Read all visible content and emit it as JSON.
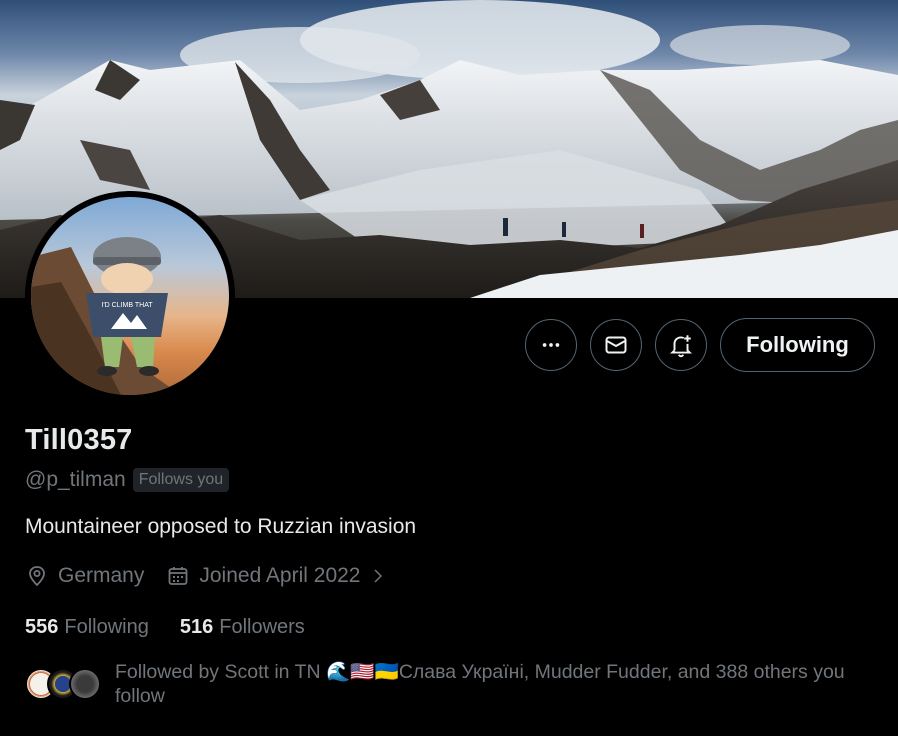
{
  "profile": {
    "display_name": "Till0357",
    "handle": "@p_tilman",
    "follows_you_badge": "Follows you",
    "bio": "Mountaineer opposed to Ruzzian invasion",
    "location": "Germany",
    "joined": "Joined April 2022",
    "avatar_shirt_text": "I'D CLIMB THAT"
  },
  "actions": {
    "more_icon": "more-horizontal-icon",
    "message_icon": "mail-icon",
    "notify_icon": "bell-plus-icon",
    "follow_label": "Following"
  },
  "stats": {
    "following_count": "556",
    "following_label": "Following",
    "followers_count": "516",
    "followers_label": "Followers"
  },
  "followed_by": {
    "text": "Followed by Scott in TN 🌊🇺🇸🇺🇦Слава Україні, Mudder Fudder, and 388 others you follow"
  },
  "colors": {
    "background": "#000000",
    "primary_text": "#e7e9ea",
    "secondary_text": "#71767b",
    "border": "#536471"
  }
}
